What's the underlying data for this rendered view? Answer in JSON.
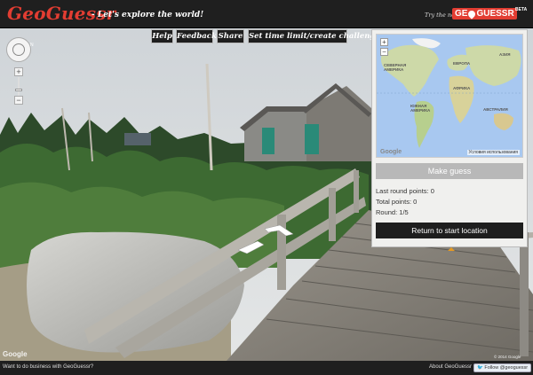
{
  "header": {
    "logo": "GeoGuessr",
    "tagline": "- Let's explore the world!",
    "try_new": "Try the new",
    "brand_left": "GE",
    "brand_right": "GUESSR",
    "beta": "BETA"
  },
  "menu": {
    "help": "Help",
    "feedback": "Feedback",
    "share": "Share",
    "time_limit": "Set time limit/create challenge"
  },
  "streetview": {
    "compass_north": "N",
    "zoom_in": "+",
    "zoom_out": "−",
    "google": "Google",
    "copyright": "© 2014 Google"
  },
  "panel": {
    "map_zoom_in": "+",
    "map_zoom_out": "−",
    "map_google": "Google",
    "map_terms": "Условия использования",
    "continents": {
      "north_america": "СЕВЕРНАЯ АМЕРИКА",
      "europe": "ЕВРОПА",
      "asia": "АЗИЯ",
      "africa": "АФРИКА",
      "south_america": "ЮЖНАЯ АМЕРИКА",
      "australia": "АВСТРАЛИЯ"
    },
    "make_guess": "Make guess",
    "last_round_label": "Last round points: 0",
    "total_label": "Total points: 0",
    "round_label": "Round: 1/5",
    "return_btn": "Return to start location"
  },
  "footer": {
    "business": "Want to do business with GeoGuessr?",
    "about": "About GeoGuessr",
    "twitter": "Follow @geoguessr"
  },
  "colors": {
    "brand_red": "#e23d32",
    "bar": "#1f1f1f",
    "guess_btn": "#b8b8b8",
    "accent_orange": "#e69a22"
  }
}
